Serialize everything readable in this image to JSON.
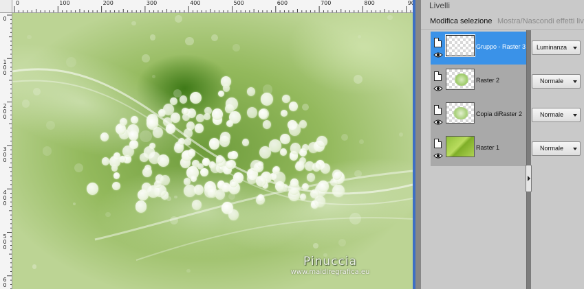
{
  "ruler_top": {
    "labels": [
      "0",
      "100",
      "200",
      "300",
      "400",
      "500",
      "600",
      "700",
      "800",
      "900"
    ]
  },
  "ruler_left": {
    "labels": [
      "0",
      "1\n0\n0",
      "2\n0\n0",
      "3\n0\n0",
      "4\n0\n0",
      "5\n0\n0",
      "6\n0"
    ]
  },
  "canvas": {
    "watermark_title": "Pinuccia",
    "watermark_url": "www.maidiregrafica.eu"
  },
  "panel": {
    "title": "Livelli",
    "tab_edit_selection": "Modifica selezione",
    "tab_show_hide_effects": "Mostra/Nascondi effetti livello"
  },
  "layers": [
    {
      "name": "Gruppo - Raster 3",
      "blend_mode": "Luminanza",
      "selected": true,
      "thumb": "empty"
    },
    {
      "name": "Raster 2",
      "blend_mode": "Normale",
      "selected": false,
      "thumb": "flowers"
    },
    {
      "name": "Copia diRaster 2",
      "blend_mode": "Normale",
      "selected": false,
      "thumb": "flowers"
    },
    {
      "name": "Raster 1",
      "blend_mode": "Normale",
      "selected": false,
      "thumb": "green"
    }
  ],
  "colors": {
    "selection_blue": "#3a92e8",
    "window_frame_blue": "#4b78c6",
    "panel_bg": "#c9c9c9"
  }
}
